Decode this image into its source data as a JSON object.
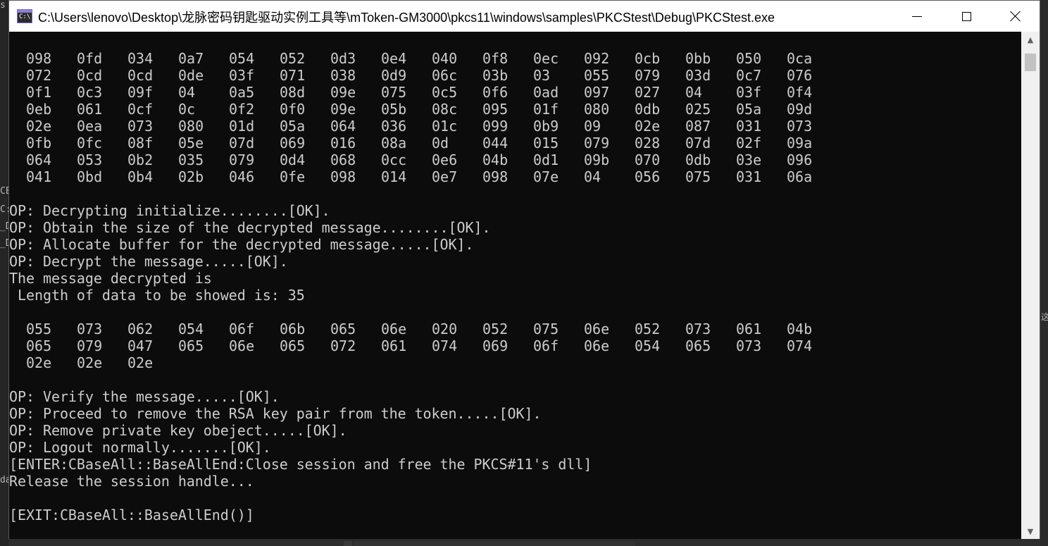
{
  "window": {
    "title": "C:\\Users\\lenovo\\Desktop\\龙脉密码钥匙驱动实例工具等\\mToken-GM3000\\pkcs11\\windows\\samples\\PKCStest\\Debug\\PKCStest.exe",
    "icon": "console-app-icon",
    "icon_text": "C:\\",
    "controls": [
      "minimize-icon",
      "maximize-icon",
      "close-icon"
    ]
  },
  "hex_rows_top": [
    [
      "098",
      "0fd",
      "034",
      "0a7",
      "054",
      "052",
      "0d3",
      "0e4",
      "040",
      "0f8",
      "0ec",
      "092",
      "0cb",
      "0bb",
      "050",
      "0ca"
    ],
    [
      "072",
      "0cd",
      "0cd",
      "0de",
      "03f",
      "071",
      "038",
      "0d9",
      "06c",
      "03b",
      "03",
      "055",
      "079",
      "03d",
      "0c7",
      "076"
    ],
    [
      "0f1",
      "0c3",
      "09f",
      "04",
      "0a5",
      "08d",
      "09e",
      "075",
      "0c5",
      "0f6",
      "0ad",
      "097",
      "027",
      "04",
      "03f",
      "0f4"
    ],
    [
      "0eb",
      "061",
      "0cf",
      "0c",
      "0f2",
      "0f0",
      "09e",
      "05b",
      "08c",
      "095",
      "01f",
      "080",
      "0db",
      "025",
      "05a",
      "09d"
    ],
    [
      "02e",
      "0ea",
      "073",
      "080",
      "01d",
      "05a",
      "064",
      "036",
      "01c",
      "099",
      "0b9",
      "09",
      "02e",
      "087",
      "031",
      "073"
    ],
    [
      "0fb",
      "0fc",
      "08f",
      "05e",
      "07d",
      "069",
      "016",
      "08a",
      "0d",
      "044",
      "015",
      "079",
      "028",
      "07d",
      "02f",
      "09a"
    ],
    [
      "064",
      "053",
      "0b2",
      "035",
      "079",
      "0d4",
      "068",
      "0cc",
      "0e6",
      "04b",
      "0d1",
      "09b",
      "070",
      "0db",
      "03e",
      "096"
    ],
    [
      "041",
      "0bd",
      "0b4",
      "02b",
      "046",
      "0fe",
      "098",
      "014",
      "0e7",
      "098",
      "07e",
      "04",
      "056",
      "075",
      "031",
      "06a"
    ]
  ],
  "lines_mid": [
    "OP: Decrypting initialize........[OK].",
    "OP: Obtain the size of the decrypted message........[OK].",
    "OP: Allocate buffer for the decrypted message.....[OK].",
    "OP: Decrypt the message.....[OK].",
    "The message decrypted is",
    " Length of data to be showed is: 35"
  ],
  "hex_rows_msg": [
    [
      "055",
      "073",
      "062",
      "054",
      "06f",
      "06b",
      "065",
      "06e",
      "020",
      "052",
      "075",
      "06e",
      "052",
      "073",
      "061",
      "04b"
    ],
    [
      "065",
      "079",
      "047",
      "065",
      "06e",
      "065",
      "072",
      "061",
      "074",
      "069",
      "06f",
      "06e",
      "054",
      "065",
      "073",
      "074"
    ],
    [
      "02e",
      "02e",
      "02e"
    ]
  ],
  "lines_bottom": [
    "OP: Verify the message.....[OK].",
    "OP: Proceed to remove the RSA key pair from the token.....[OK].",
    "OP: Remove private key obeject.....[OK].",
    "OP: Logout normally.......[OK].",
    "[ENTER:CBaseAll::BaseAllEnd:Close session and free the PKCS#11's dll]",
    "Release the session handle...",
    "",
    "[EXIT:CBaseAll::BaseAllEnd()]"
  ],
  "desktop_fragments": {
    "left": [
      "s I",
      "CE",
      "C:",
      "_D",
      "_D",
      "da"
    ],
    "right": "这"
  },
  "scrollbar": {
    "up_icon": "▲",
    "down_icon": "▼"
  },
  "colors": {
    "console_bg": "#0c0c0c",
    "console_fg": "#cccccc",
    "titlebar_bg": "#ffffff"
  }
}
